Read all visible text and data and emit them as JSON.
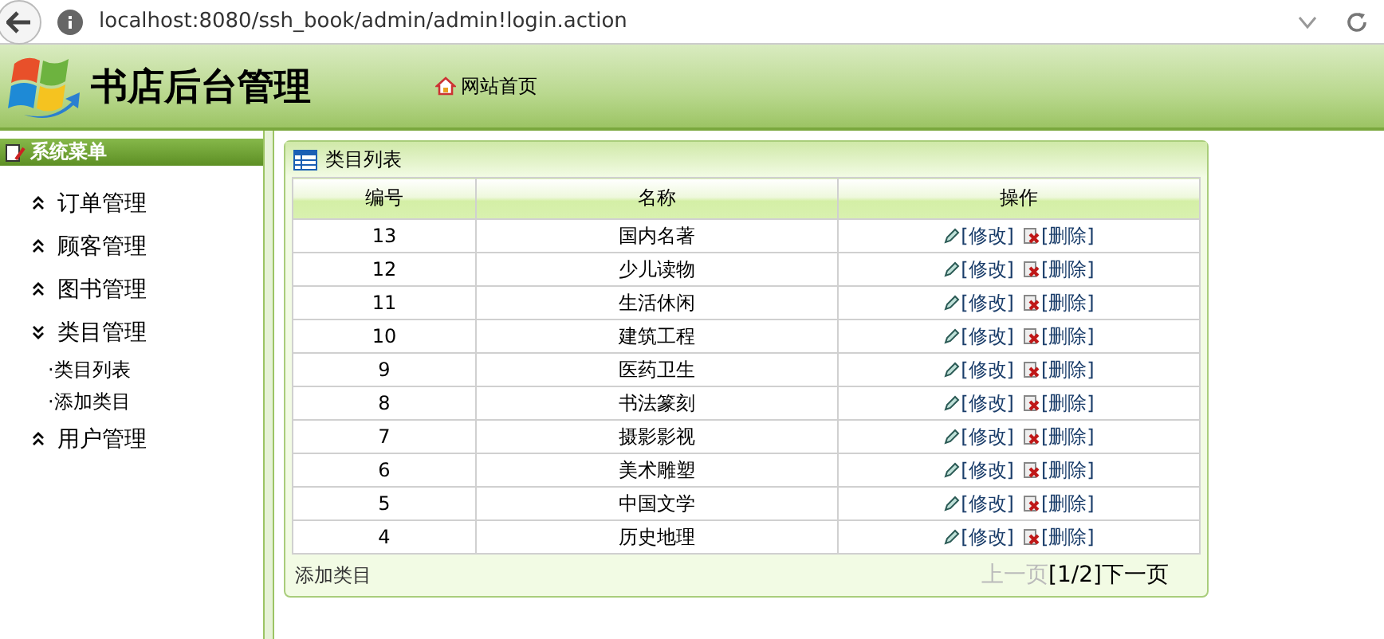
{
  "browser": {
    "url": "localhost:8080/ssh_book/admin/admin!login.action"
  },
  "header": {
    "title": "书店后台管理",
    "home_link": "网站首页"
  },
  "sidebar": {
    "title": "系统菜单",
    "items": [
      {
        "label": "订单管理",
        "expanded": false
      },
      {
        "label": "顾客管理",
        "expanded": false
      },
      {
        "label": "图书管理",
        "expanded": false
      },
      {
        "label": "类目管理",
        "expanded": true,
        "children": [
          {
            "label": "·类目列表"
          },
          {
            "label": "·添加类目"
          }
        ]
      },
      {
        "label": "用户管理",
        "expanded": false
      }
    ]
  },
  "panel": {
    "title": "类目列表",
    "table": {
      "columns": [
        "编号",
        "名称",
        "操作"
      ],
      "rows": [
        {
          "id": "13",
          "name": "国内名著",
          "edit": "[修改]",
          "delete": "[删除]"
        },
        {
          "id": "12",
          "name": "少儿读物",
          "edit": "[修改]",
          "delete": "[删除]"
        },
        {
          "id": "11",
          "name": "生活休闲",
          "edit": "[修改]",
          "delete": "[删除]"
        },
        {
          "id": "10",
          "name": "建筑工程",
          "edit": "[修改]",
          "delete": "[删除]"
        },
        {
          "id": "9",
          "name": "医药卫生",
          "edit": "[修改]",
          "delete": "[删除]"
        },
        {
          "id": "8",
          "name": "书法篆刻",
          "edit": "[修改]",
          "delete": "[删除]"
        },
        {
          "id": "7",
          "name": "摄影影视",
          "edit": "[修改]",
          "delete": "[删除]"
        },
        {
          "id": "6",
          "name": "美术雕塑",
          "edit": "[修改]",
          "delete": "[删除]"
        },
        {
          "id": "5",
          "name": "中国文学",
          "edit": "[修改]",
          "delete": "[删除]"
        },
        {
          "id": "4",
          "name": "历史地理",
          "edit": "[修改]",
          "delete": "[删除]"
        }
      ]
    },
    "add_link": "添加类目",
    "pager": {
      "prev": {
        "label": "上一页",
        "disabled": true
      },
      "page": "[1/2]",
      "next": {
        "label": "下一页",
        "disabled": false
      }
    }
  }
}
